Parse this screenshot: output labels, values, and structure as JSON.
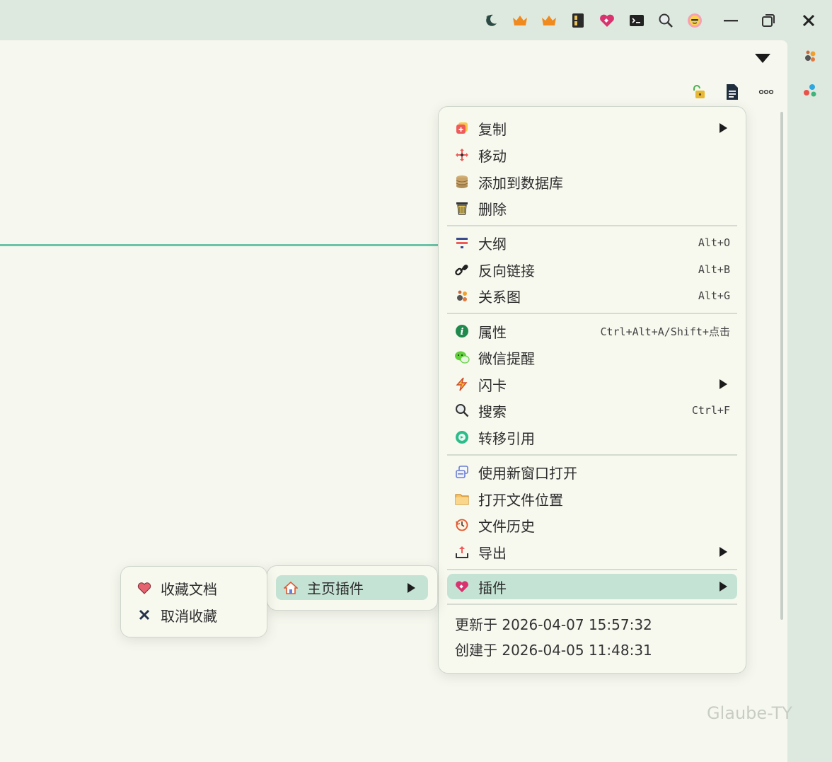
{
  "title_bar": {
    "icons": [
      "moon-star-icon",
      "crown-icon",
      "crown-icon",
      "film-strip-icon",
      "plugin-heart-icon",
      "terminal-icon",
      "search-icon",
      "sun-face-icon"
    ],
    "controls": [
      "minimize-icon",
      "restore-icon",
      "close-icon"
    ]
  },
  "right_dock": {
    "icons": [
      "graph-icon",
      "dots-icon"
    ]
  },
  "doc_toolbar": {
    "icons": [
      "lock-icon",
      "document-icon",
      "more-icon"
    ]
  },
  "main_menu": {
    "groups": [
      [
        {
          "label": "复制",
          "icon": "copy-icon",
          "submenu": true
        },
        {
          "label": "移动",
          "icon": "move-icon"
        },
        {
          "label": "添加到数据库",
          "icon": "database-icon"
        },
        {
          "label": "删除",
          "icon": "trash-icon"
        }
      ],
      [
        {
          "label": "大纲",
          "icon": "outline-icon",
          "shortcut": "Alt+O"
        },
        {
          "label": "反向链接",
          "icon": "link-icon",
          "shortcut": "Alt+B"
        },
        {
          "label": "关系图",
          "icon": "graph-icon",
          "shortcut": "Alt+G"
        }
      ],
      [
        {
          "label": "属性",
          "icon": "info-icon",
          "shortcut": "Ctrl+Alt+A/Shift+点击"
        },
        {
          "label": "微信提醒",
          "icon": "wechat-icon"
        },
        {
          "label": "闪卡",
          "icon": "flash-icon",
          "submenu": true
        },
        {
          "label": "搜索",
          "icon": "search-icon",
          "shortcut": "Ctrl+F"
        },
        {
          "label": "转移引用",
          "icon": "transfer-icon"
        }
      ],
      [
        {
          "label": "使用新窗口打开",
          "icon": "new-window-icon"
        },
        {
          "label": "打开文件位置",
          "icon": "folder-icon"
        },
        {
          "label": "文件历史",
          "icon": "history-icon"
        },
        {
          "label": "导出",
          "icon": "export-icon",
          "submenu": true
        }
      ],
      [
        {
          "label": "插件",
          "icon": "plugin-heart-icon",
          "submenu": true,
          "active": true
        }
      ]
    ],
    "updated": "更新于 2026-04-07 15:57:32",
    "created": "创建于 2026-04-05 11:48:31"
  },
  "plugin_submenu": {
    "items": [
      {
        "label": "主页插件",
        "icon": "home-icon",
        "submenu": true,
        "active": true
      }
    ]
  },
  "fav_submenu": {
    "items": [
      {
        "label": "收藏文档",
        "icon": "heart-icon"
      },
      {
        "label": "取消收藏",
        "icon": "x-icon"
      }
    ]
  },
  "watermark": "Glaube-TY",
  "colors": {
    "accent": "#6cc3a8",
    "active_bg": "#c5e3d4",
    "editor_bg": "#f6f8ef",
    "chrome_bg": "#dde9df"
  }
}
